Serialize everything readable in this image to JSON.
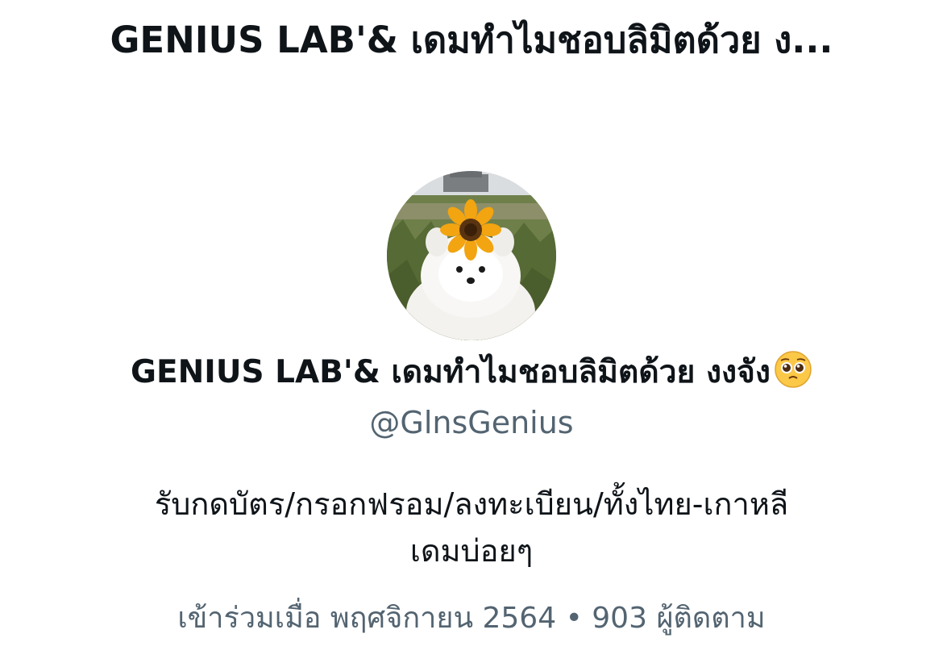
{
  "header": {
    "title": "GENIUS LAB'& เดมทำไมชอบลิมิตด้วย ง..."
  },
  "profile": {
    "avatar_icon": "dog-with-sunflower-avatar",
    "display_name": "GENIUS LAB'& เดมทำไมชอบลิมิตด้วย งงจัง",
    "name_emoji": "pleading-face-icon",
    "handle": "@GlnsGenius",
    "bio_line1": "รับกดบัตร/กรอกฟรอม/ลงทะเบียน/ทั้งไทย-เกาหลี",
    "bio_line2": "เดมบ่อยๆ",
    "joined": "เข้าร่วมเมื่อ พฤศจิกายน 2564",
    "separator": "•",
    "followers_count": "903",
    "followers_label": "ผู้ติดตาม"
  },
  "colors": {
    "text_primary": "#0f1419",
    "text_secondary": "#536471",
    "background": "#ffffff"
  }
}
